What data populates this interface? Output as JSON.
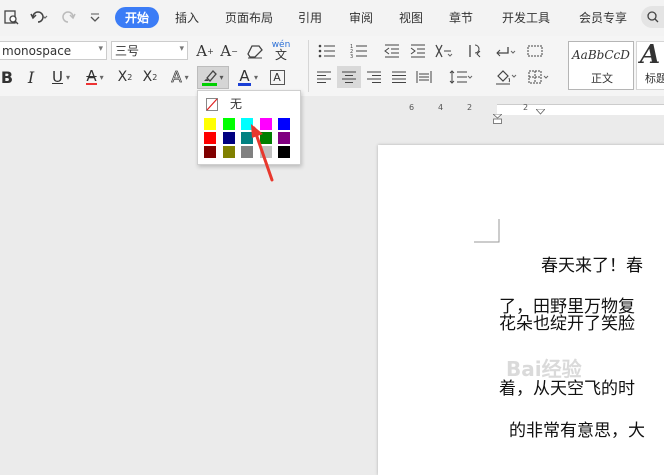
{
  "tabs": [
    {
      "label": "开始",
      "active": true
    },
    {
      "label": "插入"
    },
    {
      "label": "页面布局"
    },
    {
      "label": "引用"
    },
    {
      "label": "审阅"
    },
    {
      "label": "视图"
    },
    {
      "label": "章节"
    },
    {
      "label": "开发工具"
    },
    {
      "label": "会员专享"
    }
  ],
  "font": {
    "name": "monospace",
    "size": "三号"
  },
  "styles": [
    {
      "preview": "AaBbCcD",
      "label": "正文"
    },
    {
      "preview": "A",
      "label": "标题"
    }
  ],
  "ruler_labels": [
    "6",
    "4",
    "2",
    "2"
  ],
  "highlight_menu": {
    "none_label": "无",
    "colors": [
      "#ffff00",
      "#00ff00",
      "#00ffff",
      "#ff00ff",
      "#0000ff",
      "#ff0000",
      "#000080",
      "#008080",
      "#008000",
      "#800080",
      "#800000",
      "#808000",
      "#808080",
      "#c0c0c0",
      "#000000"
    ]
  },
  "document": {
    "lines": [
      "春天来了！春",
      "了，田野里万物复",
      "花朵也绽开了笑脸",
      "着，从天空飞的时",
      "的非常有意思，大"
    ]
  },
  "watermark": "Bai经验",
  "colors": {
    "accent": "#3b7cf6",
    "arrow": "#e8382d"
  }
}
